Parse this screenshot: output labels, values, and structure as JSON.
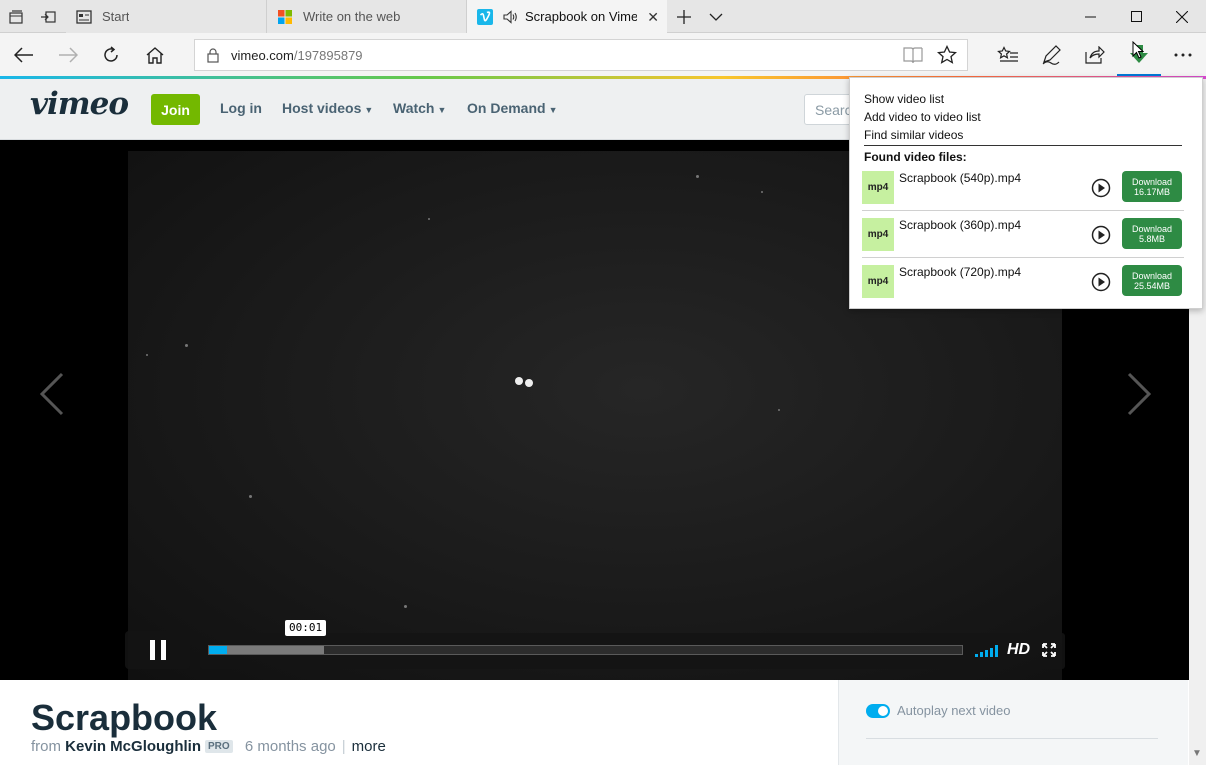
{
  "browser": {
    "tabs": [
      {
        "label": "Start",
        "active": false
      },
      {
        "label": "Write on the web",
        "active": false
      },
      {
        "label": "Scrapbook on Vime",
        "active": true
      }
    ],
    "address": {
      "host": "vimeo.com",
      "path": "/197895879"
    }
  },
  "site": {
    "logo": "vimeo",
    "join_label": "Join",
    "login_label": "Log in",
    "nav": [
      {
        "label": "Host videos"
      },
      {
        "label": "Watch"
      },
      {
        "label": "On Demand"
      }
    ],
    "search_placeholder": "Search"
  },
  "player": {
    "time_tooltip": "00:01",
    "progress_played": 0.024,
    "progress_buffered": 0.153,
    "hd_label": "HD"
  },
  "video": {
    "title": "Scrapbook",
    "from_label": "from",
    "author": "Kevin McGloughlin",
    "badge": "PRO",
    "age": "6 months ago",
    "more_label": "more"
  },
  "sidebar": {
    "autoplay_label": "Autoplay next video",
    "autoplay_on": true
  },
  "downloader": {
    "menu": [
      "Show video list",
      "Add video to video list",
      "Find similar videos"
    ],
    "found_header": "Found video files:",
    "files": [
      {
        "type": "mp4",
        "name": "Scrapbook (540p).mp4",
        "button": "Download",
        "size": "16.17MB"
      },
      {
        "type": "mp4",
        "name": "Scrapbook (360p).mp4",
        "button": "Download",
        "size": "5.8MB"
      },
      {
        "type": "mp4",
        "name": "Scrapbook (720p).mp4",
        "button": "Download",
        "size": "25.54MB"
      }
    ]
  },
  "colors": {
    "vimeo_brand": "#1ab7ea",
    "join_green": "#73b800",
    "download_green": "#2e8b44",
    "mp4_badge": "#c6f0a0",
    "progress_blue": "#00adef"
  }
}
